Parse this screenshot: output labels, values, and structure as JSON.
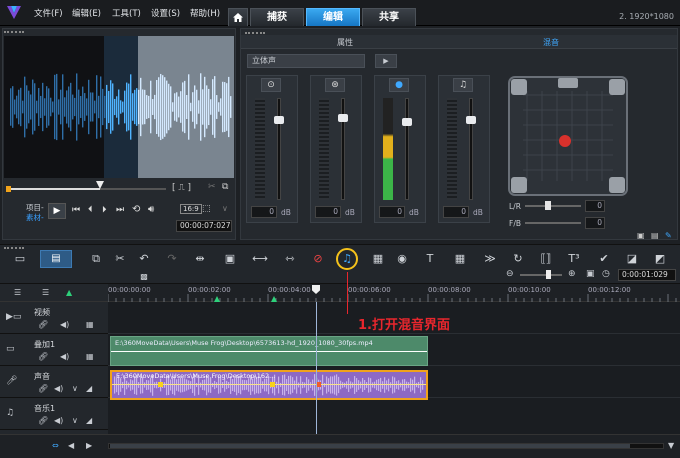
{
  "menu": [
    "文件(F)",
    "编辑(E)",
    "工具(T)",
    "设置(S)",
    "帮助(H)"
  ],
  "tabs": {
    "capture": "捕获",
    "edit": "编辑",
    "share": "共享"
  },
  "resolution": "2. 1920*1080",
  "preview": {
    "project_label": "项目-",
    "clip_label": "素材-",
    "timecode": "00:00:07:027",
    "scale": "16:9"
  },
  "mixer": {
    "tab_attributes": "属性",
    "tab_surround": "混音",
    "mode": "立体声",
    "db_unit": "dB",
    "channel_values": [
      "0",
      "0",
      "0",
      "0"
    ],
    "lr_label": "L/R",
    "fb_label": "F/B",
    "lr_value": "0",
    "fb_value": "0"
  },
  "toolbar": {
    "timecode": "0:00:01:029"
  },
  "ruler": {
    "ticks": [
      "00:00:00:00",
      "00:00:02:00",
      "00:00:04:00",
      "00:00:06:00",
      "00:00:08:00",
      "00:00:10:00",
      "00:00:12:00"
    ]
  },
  "tracks": [
    {
      "name": "视频"
    },
    {
      "name": "叠加1"
    },
    {
      "name": "声音"
    },
    {
      "name": "音乐1"
    }
  ],
  "clips": {
    "overlay": "E:\\360MoveData\\Users\\Muse Frog\\Desktop\\6573613-hd_1920_1080_30fps.mp4",
    "audio": "E:\\360MoveData\\Users\\Muse Frog\\Desktop\\162..."
  },
  "annotation": "1.打开混音界面",
  "colors": {
    "accent": "#1a8ee8",
    "annotation": "#e8262d",
    "overlay_clip": "#4d8a6a",
    "audio_clip": "#8d69c4"
  }
}
